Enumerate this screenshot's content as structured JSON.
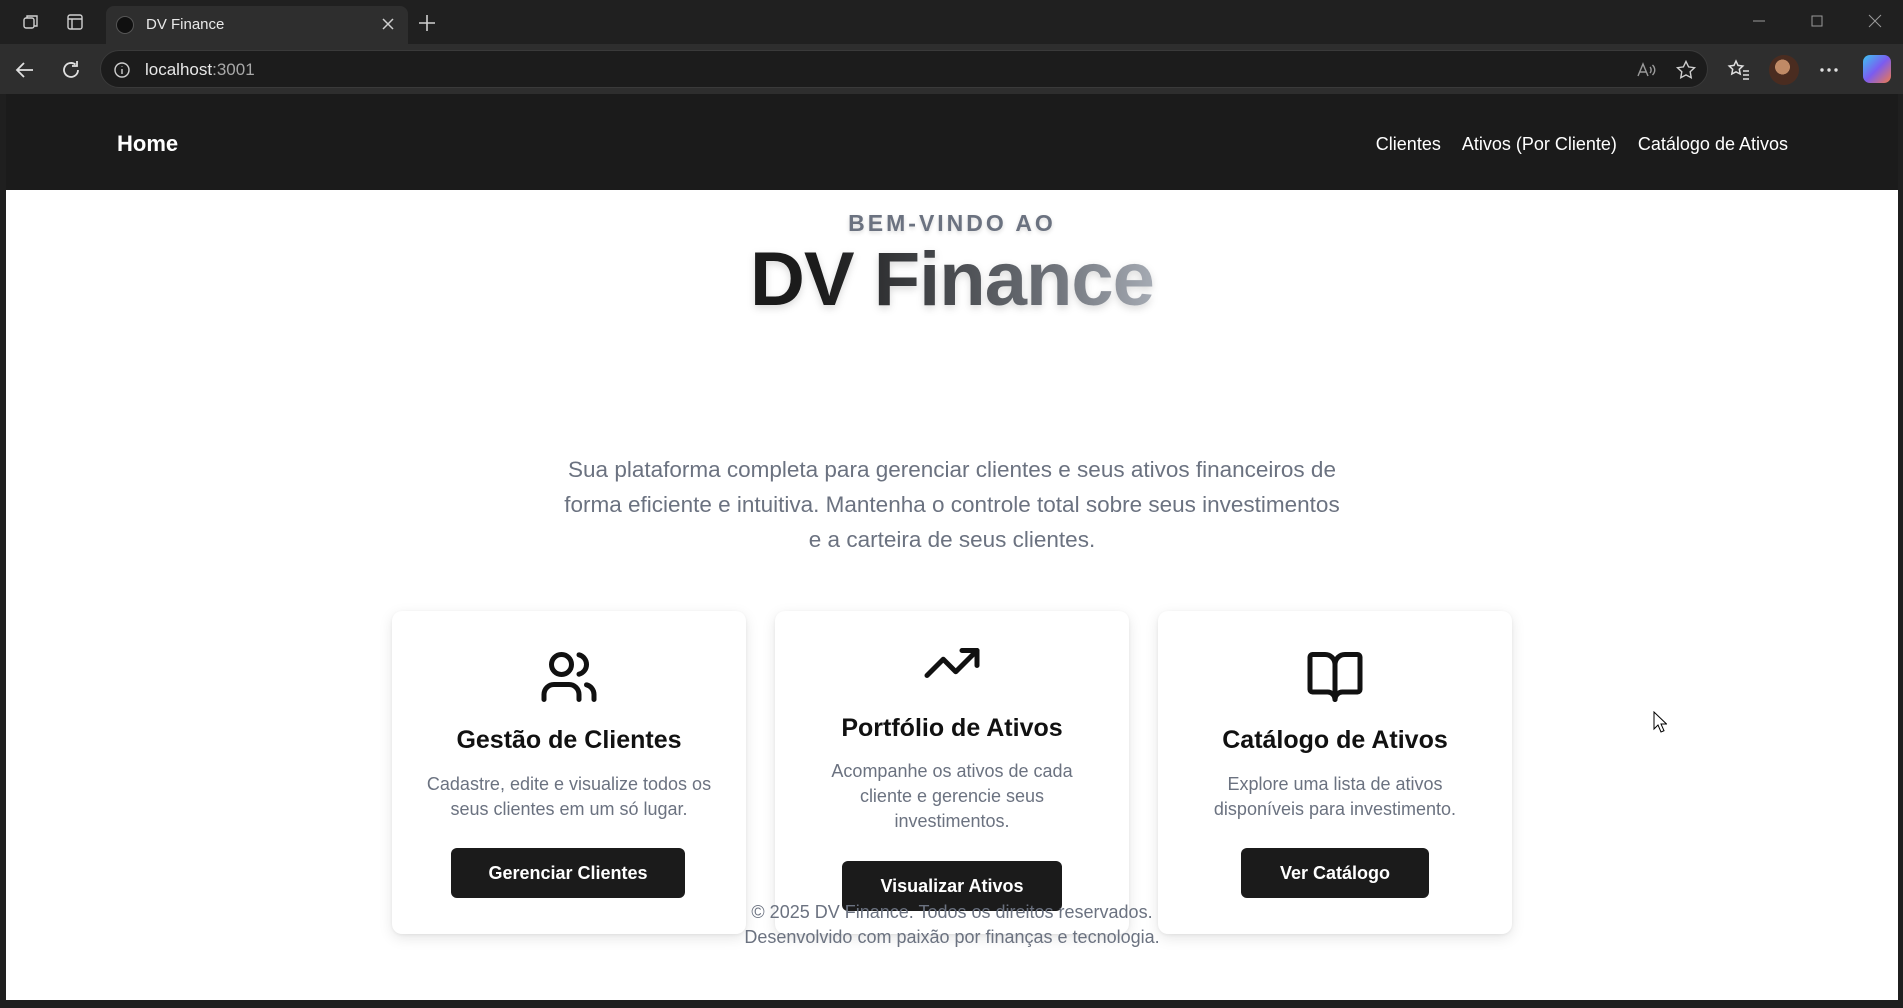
{
  "browser": {
    "tab_title": "DV Finance",
    "url_host": "localhost",
    "url_port": ":3001"
  },
  "navbar": {
    "brand": "Home",
    "links": [
      "Clientes",
      "Ativos (Por Cliente)",
      "Catálogo de Ativos"
    ]
  },
  "hero": {
    "welcome": "BEM-VINDO AO",
    "title": "DV Finance",
    "subtitle_lines": [
      "Sua plataforma completa para gerenciar clientes e seus ativos financeiros de",
      "forma eficiente e intuitiva. Mantenha o controle total sobre seus investimentos",
      "e a carteira de seus clientes."
    ]
  },
  "cards": [
    {
      "icon": "users-icon",
      "title": "Gestão de Clientes",
      "desc_lines": [
        "Cadastre, edite e visualize todos os",
        "seus clientes em um só lugar."
      ],
      "button": "Gerenciar Clientes"
    },
    {
      "icon": "trending-up-icon",
      "title": "Portfólio de Ativos",
      "desc_lines": [
        "Acompanhe os ativos de cada",
        "cliente e gerencie seus",
        "investimentos."
      ],
      "button": "Visualizar Ativos"
    },
    {
      "icon": "book-open-icon",
      "title": "Catálogo de Ativos",
      "desc_lines": [
        "Explore uma lista de ativos",
        "disponíveis para investimento."
      ],
      "button": "Ver Catálogo"
    }
  ],
  "footer": {
    "line1": "© 2025 DV Finance. Todos os direitos reservados.",
    "line2": "Desenvolvido com paixão por finanças e tecnologia."
  }
}
